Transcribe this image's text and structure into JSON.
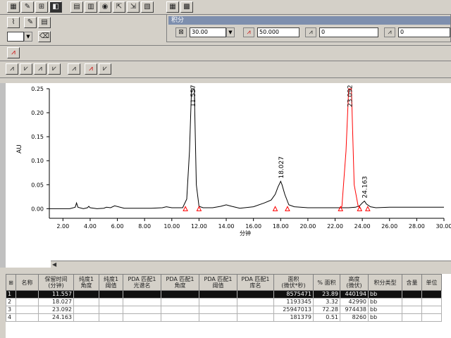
{
  "integration_panel": {
    "title": "积分",
    "field1_value": "30.00",
    "field2_value": "50.000",
    "field3_value": "0",
    "field4_value": "0"
  },
  "chart_data": {
    "type": "line",
    "xlabel": "分钟",
    "ylabel": "AU",
    "xlim": [
      1.0,
      30.0
    ],
    "ylim": [
      -0.02,
      0.25
    ],
    "xticks": [
      "2.00",
      "4.00",
      "6.00",
      "8.00",
      "10.00",
      "12.00",
      "14.00",
      "16.00",
      "18.00",
      "20.00",
      "22.00",
      "24.00",
      "26.00",
      "28.00",
      "30.00"
    ],
    "yticks": [
      "0.00",
      "0.05",
      "0.10",
      "0.15",
      "0.20",
      "0.25"
    ],
    "series": [
      {
        "color": "#000000",
        "x": [
          1.0,
          2.5,
          2.9,
          3.0,
          3.1,
          3.5,
          3.8,
          3.9,
          4.0,
          4.5,
          5.0,
          5.2,
          5.5,
          5.8,
          6.5,
          7.5,
          8.5,
          9.3,
          9.6,
          10.0,
          10.8,
          11.1,
          11.3,
          11.45,
          11.55,
          11.65,
          11.8,
          12.0,
          12.3,
          13.0,
          13.6,
          14.0,
          14.4,
          15.0,
          16.0,
          16.8,
          17.3,
          17.6,
          17.8,
          18.0,
          18.1,
          18.3,
          18.6,
          19.0,
          20.0,
          21.0,
          22.0,
          22.5,
          23.0,
          23.5,
          23.8,
          24.0,
          24.16,
          24.3,
          24.6,
          25.0,
          26.0,
          27.0,
          28.0,
          29.0,
          30.0
        ],
        "y": [
          0.0,
          0.0,
          0.003,
          0.012,
          0.003,
          0.0,
          0.002,
          0.005,
          0.002,
          0.0,
          0.001,
          0.003,
          0.002,
          0.006,
          0.001,
          0.001,
          0.001,
          0.002,
          0.004,
          0.002,
          0.002,
          0.02,
          0.12,
          0.25,
          0.25,
          0.25,
          0.05,
          0.005,
          0.002,
          0.002,
          0.005,
          0.008,
          0.005,
          0.001,
          0.004,
          0.012,
          0.018,
          0.03,
          0.045,
          0.057,
          0.05,
          0.03,
          0.008,
          0.004,
          0.002,
          0.002,
          0.002,
          0.002,
          0.002,
          0.003,
          0.006,
          0.012,
          0.016,
          0.01,
          0.004,
          0.002,
          0.003,
          0.003,
          0.003,
          0.003,
          0.003
        ]
      },
      {
        "color": "#ff0000",
        "x": [
          22.3,
          22.5,
          22.8,
          23.0,
          23.09,
          23.2,
          23.4,
          23.7,
          23.9
        ],
        "y": [
          0.0,
          0.005,
          0.12,
          0.25,
          0.25,
          0.25,
          0.05,
          0.005,
          0.0
        ]
      }
    ],
    "peaks": [
      {
        "rt": 11.557,
        "label": "11.557"
      },
      {
        "rt": 18.027,
        "label": "18.027"
      },
      {
        "rt": 23.092,
        "label": "23.092"
      },
      {
        "rt": 24.163,
        "label": "24.163"
      }
    ],
    "markers_x": [
      11.0,
      12.0,
      17.6,
      18.5,
      22.4,
      23.8,
      24.4
    ]
  },
  "table": {
    "headers": [
      "名称",
      "保留时间\n(分钟)",
      "纯度1\n角度",
      "纯度1\n阈值",
      "PDA 匹配1\n光谱名",
      "PDA 匹配1\n角度",
      "PDA 匹配1\n阈值",
      "PDA 匹配1\n库名",
      "面积\n(微伏*秒)",
      "% 面积",
      "高度\n(微伏)",
      "积分类型",
      "含量",
      "单位"
    ],
    "rows": [
      {
        "index": "1",
        "rt": "11.557",
        "area": "8575471",
        "pct": "23.89",
        "height": "440194",
        "type": "bb"
      },
      {
        "index": "2",
        "rt": "18.027",
        "area": "1193345",
        "pct": "3.32",
        "height": "42990",
        "type": "bb"
      },
      {
        "index": "3",
        "rt": "23.092",
        "area": "25947013",
        "pct": "72.28",
        "height": "974438",
        "type": "bb"
      },
      {
        "index": "4",
        "rt": "24.163",
        "area": "181379",
        "pct": "0.51",
        "height": "8260",
        "type": "bb"
      }
    ]
  }
}
